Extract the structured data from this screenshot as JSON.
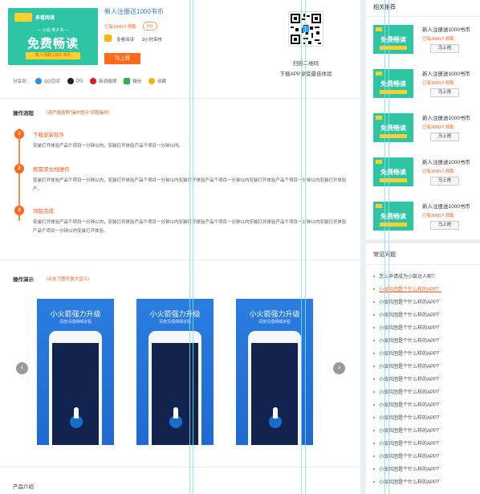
{
  "product": {
    "banner_app": "多看阅读",
    "banner_sub": "— 小说 电子书 —",
    "banner_big": "免费畅读",
    "banner_tag": "新人领取 1000 书币",
    "title": "新人注册送1000书币",
    "claimed": "已有1000人领取",
    "score_badge": "5分",
    "publisher": "多看阅读",
    "time": "8小时审核",
    "button": "马上抢"
  },
  "qr": {
    "caption1": "扫描二维码",
    "caption2": "下载APP享受最佳体验"
  },
  "share": {
    "label": "分享到：",
    "items": [
      {
        "label": "QQ空间",
        "color": "#2b8ee8"
      },
      {
        "label": "QQ",
        "color": "#222222"
      },
      {
        "label": "新浪微博",
        "color": "#e6162d"
      },
      {
        "label": "微信",
        "color": "#2bb24c"
      },
      {
        "label": "收藏",
        "color": "#f5b400"
      }
    ]
  },
  "process": {
    "title": "操作流程",
    "note": "（请严格按照“操作提示”流程操作）",
    "steps": [
      {
        "num": "1",
        "title": "下载安装软件",
        "desc": "安装打开体验产品个项目一分钟以内，安装打开体验产品个项目一分钟以内。"
      },
      {
        "num": "2",
        "title": "按需求文档操作",
        "desc": "安装打开体验产品个项目一分钟以内，安装打开体验产品个项目一分钟以内安装打开体验产品个项目一分钟以内安装打开体验产品个项目一分钟以内安装打开体验产。"
      },
      {
        "num": "3",
        "title": "领取完成",
        "desc": "安装打开体验产品个项目一分钟以内，安装打开体验产品个项目一分钟以内安装打开体验产品个项目一分钟以内安装打开体验产品个项目一分钟以内安装打开体验产品个项目一分钟以内安装打开体验。"
      }
    ]
  },
  "demo": {
    "title": "操作演示",
    "note": "（点击下图可放大显示）",
    "shots": [
      {
        "h1": "小火箭强力升级",
        "h2": "深度清理细细进程"
      },
      {
        "h1": "小火箭强力升级",
        "h2": "深度清理细细进程"
      },
      {
        "h1": "小火箭强力升级",
        "h2": "深度清理细细进程"
      }
    ],
    "prev": "‹",
    "next": "›"
  },
  "intro": {
    "title": "产品介绍"
  },
  "related": {
    "title": "相关推荐",
    "items": [
      {
        "title": "新人注册送1000书币",
        "claimed": "已有3000人领取",
        "button": "马上抢",
        "thumb": "免费畅读"
      },
      {
        "title": "新人注册送1000书币",
        "claimed": "已有3000人领取",
        "button": "马上抢",
        "thumb": "免费畅读"
      },
      {
        "title": "新人注册送1000书币",
        "claimed": "已有3000人领取",
        "button": "马上抢",
        "thumb": "免费畅读"
      },
      {
        "title": "新人注册送1000书币",
        "claimed": "已有3000人领取",
        "button": "马上抢",
        "thumb": "免费畅读"
      },
      {
        "title": "新人注册送1000书币",
        "claimed": "已有3000人领取",
        "button": "马上抢",
        "thumb": "免费畅读"
      }
    ]
  },
  "faq": {
    "title": "常见问题",
    "items": [
      "怎么申请成为小蚁达人呢？",
      "小蚁兵团是个什么样的APP？",
      "小蚁兵团是个什么样的APP？",
      "小蚁兵团是个什么样的APP？",
      "小蚁兵团是个什么样的APP？",
      "小蚁兵团是个什么样的APP？",
      "小蚁兵团是个什么样的APP？",
      "小蚁兵团是个什么样的APP？",
      "小蚁兵团是个什么样的APP？",
      "小蚁兵团是个什么样的APP？",
      "小蚁兵团是个什么样的APP？",
      "小蚁兵团是个什么样的APP？",
      "小蚁兵团是个什么样的APP？",
      "小蚁兵团是个什么样的APP？",
      "小蚁兵团是个什么样的APP？",
      "小蚁兵团是个什么样的APP？",
      "小蚁兵团是个什么样的APP？"
    ],
    "active_index": 1
  }
}
